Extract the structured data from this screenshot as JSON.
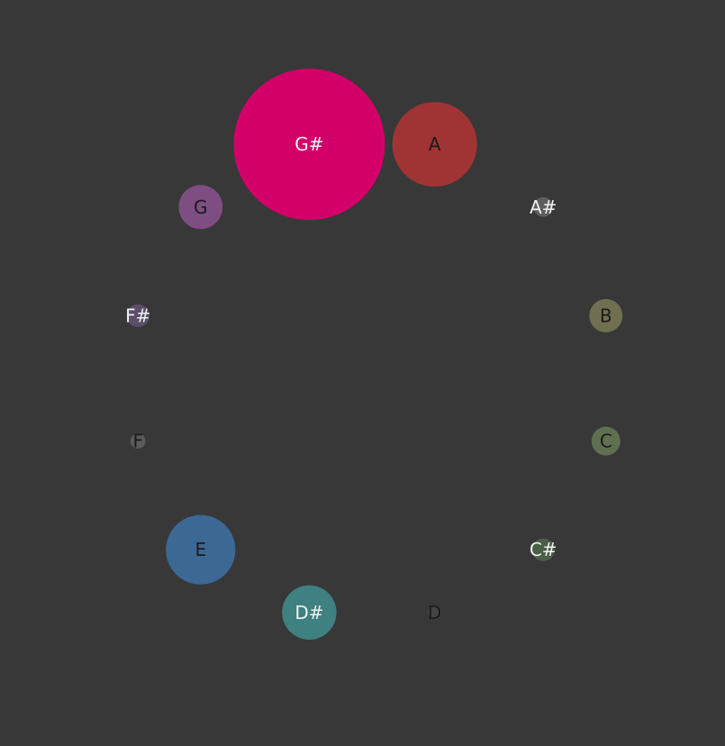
{
  "chart_data": {
    "type": "bubble",
    "layout": "circle",
    "notes": [
      {
        "label": "A",
        "value": 0.56,
        "color": "#a03434",
        "text_color": "#1a1a1a"
      },
      {
        "label": "A#",
        "value": 0.13,
        "color": "#5e5e5e",
        "text_color": "#f0f0f0"
      },
      {
        "label": "B",
        "value": 0.22,
        "color": "#707050",
        "text_color": "#1a1a1a"
      },
      {
        "label": "C",
        "value": 0.19,
        "color": "#5f7050",
        "text_color": "#1a1a1a"
      },
      {
        "label": "C#",
        "value": 0.15,
        "color": "#4a5e48",
        "text_color": "#f0f0f0"
      },
      {
        "label": "D",
        "value": 0.09,
        "color": "#444444",
        "text_color": "#1a1a1a"
      },
      {
        "label": "D#",
        "value": 0.36,
        "color": "#3f8080",
        "text_color": "#f0f0f0"
      },
      {
        "label": "E",
        "value": 0.46,
        "color": "#3c6894",
        "text_color": "#1a1a1a"
      },
      {
        "label": "F",
        "value": 0.1,
        "color": "#5a5a5a",
        "text_color": "#1a1a1a"
      },
      {
        "label": "F#",
        "value": 0.15,
        "color": "#5a4e6a",
        "text_color": "#f0f0f0"
      },
      {
        "label": "G",
        "value": 0.29,
        "color": "#7e4e82",
        "text_color": "#1a1a1a"
      },
      {
        "label": "G#",
        "value": 1.0,
        "color": "#d4006a",
        "text_color": "#f0f0f0"
      }
    ]
  }
}
